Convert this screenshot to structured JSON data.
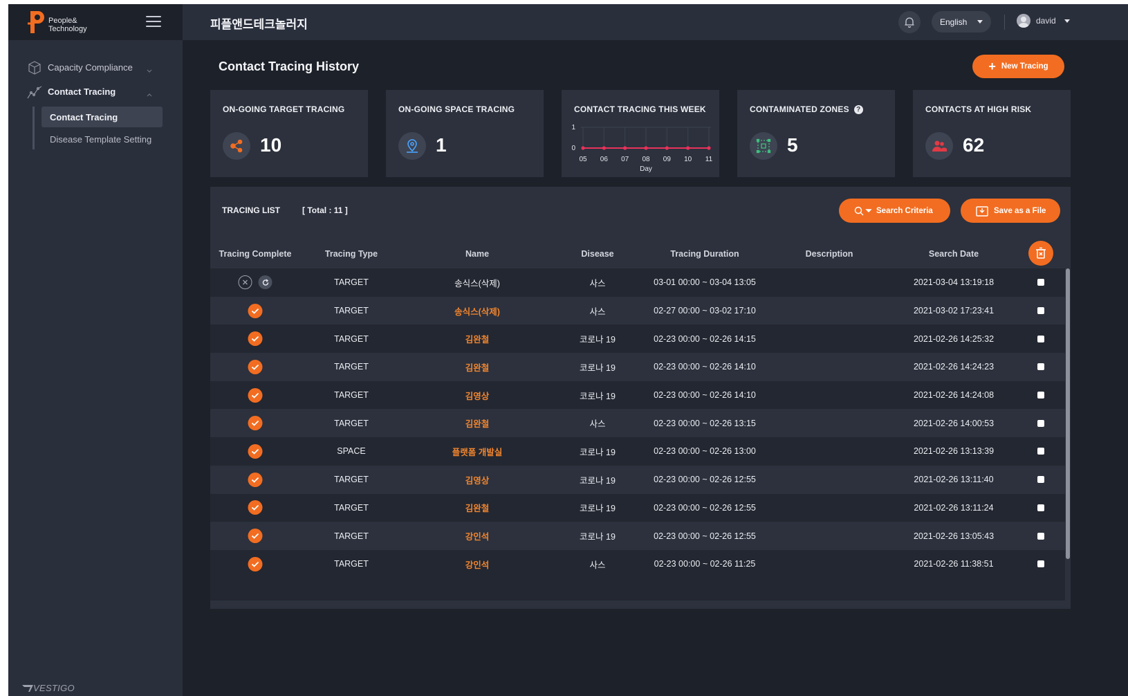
{
  "app": {
    "logo_line1": "People&",
    "logo_line2": "Technology",
    "company_name": "피플앤드테크놀러지",
    "footer_brand": "VESTIGO",
    "accent_color": "#f26d21"
  },
  "header": {
    "language": "English",
    "user": "david",
    "icons": [
      "bell-icon",
      "user-avatar-icon"
    ]
  },
  "sidebar": {
    "groups": [
      {
        "label": "Capacity Compliance",
        "icon": "cube-icon",
        "expanded": false
      },
      {
        "label": "Contact Tracing",
        "icon": "line-chart-icon",
        "expanded": true
      }
    ],
    "sub_items": [
      {
        "label": "Contact Tracing",
        "active": true
      },
      {
        "label": "Disease Template Setting",
        "active": false
      }
    ]
  },
  "page": {
    "title": "Contact Tracing History",
    "new_button": "New Tracing"
  },
  "cards": [
    {
      "title": "ON-GOING TARGET TRACING",
      "value": "10",
      "icon": "share-nodes-icon"
    },
    {
      "title": "ON-GOING SPACE TRACING",
      "value": "1",
      "icon": "map-pin-icon"
    },
    {
      "title": "CONTACT TRACING THIS WEEK",
      "icon": "none"
    },
    {
      "title": "CONTAMINATED ZONES",
      "value": "5",
      "icon": "zone-icon",
      "help": "?"
    },
    {
      "title": "CONTACTS AT HIGH RISK",
      "value": "62",
      "icon": "people-icon"
    }
  ],
  "chart_data": {
    "type": "line",
    "title": "CONTACT TRACING THIS WEEK",
    "x": [
      "05",
      "06",
      "07",
      "08",
      "09",
      "10",
      "11"
    ],
    "xlabel": "Day",
    "ylabel": "",
    "y_ticks": [
      "0",
      "1"
    ],
    "ylim": [
      0,
      1
    ],
    "series": [
      {
        "values": [
          0,
          0,
          0,
          0,
          0,
          0,
          0
        ],
        "color": "#e8325a"
      }
    ]
  },
  "list": {
    "title": "TRACING LIST",
    "total": "[ Total : 11 ]",
    "search_button": "Search Criteria",
    "save_button": "Save as a File",
    "columns": [
      "Tracing Complete",
      "Tracing Type",
      "Name",
      "Disease",
      "Tracing Duration",
      "Description",
      "Search Date"
    ],
    "rows": [
      {
        "status": "pending",
        "type": "TARGET",
        "name": "송식스(삭제)",
        "link": false,
        "disease": "사스",
        "duration": "03-01 00:00 ~ 03-04 13:05",
        "description": "",
        "date": "2021-03-04 13:19:18"
      },
      {
        "status": "done",
        "type": "TARGET",
        "name": "송식스(삭제)",
        "link": true,
        "disease": "사스",
        "duration": "02-27 00:00 ~ 03-02 17:10",
        "description": "",
        "date": "2021-03-02 17:23:41"
      },
      {
        "status": "done",
        "type": "TARGET",
        "name": "김완철",
        "link": true,
        "disease": "코로나 19",
        "duration": "02-23 00:00 ~ 02-26 14:15",
        "description": "",
        "date": "2021-02-26 14:25:32"
      },
      {
        "status": "done",
        "type": "TARGET",
        "name": "김완철",
        "link": true,
        "disease": "코로나 19",
        "duration": "02-23 00:00 ~ 02-26 14:10",
        "description": "",
        "date": "2021-02-26 14:24:23"
      },
      {
        "status": "done",
        "type": "TARGET",
        "name": "김영상",
        "link": true,
        "disease": "코로나 19",
        "duration": "02-23 00:00 ~ 02-26 14:10",
        "description": "",
        "date": "2021-02-26 14:24:08"
      },
      {
        "status": "done",
        "type": "TARGET",
        "name": "김완철",
        "link": true,
        "disease": "사스",
        "duration": "02-23 00:00 ~ 02-26 13:15",
        "description": "",
        "date": "2021-02-26 14:00:53"
      },
      {
        "status": "done",
        "type": "SPACE",
        "name": "플랫폼 개발실",
        "link": true,
        "disease": "코로나 19",
        "duration": "02-23 00:00 ~ 02-26 13:00",
        "description": "",
        "date": "2021-02-26 13:13:39"
      },
      {
        "status": "done",
        "type": "TARGET",
        "name": "김영상",
        "link": true,
        "disease": "코로나 19",
        "duration": "02-23 00:00 ~ 02-26 12:55",
        "description": "",
        "date": "2021-02-26 13:11:40"
      },
      {
        "status": "done",
        "type": "TARGET",
        "name": "김완철",
        "link": true,
        "disease": "코로나 19",
        "duration": "02-23 00:00 ~ 02-26 12:55",
        "description": "",
        "date": "2021-02-26 13:11:24"
      },
      {
        "status": "done",
        "type": "TARGET",
        "name": "강인석",
        "link": true,
        "disease": "코로나 19",
        "duration": "02-23 00:00 ~ 02-26 12:55",
        "description": "",
        "date": "2021-02-26 13:05:43"
      },
      {
        "status": "done",
        "type": "TARGET",
        "name": "강인석",
        "link": true,
        "disease": "사스",
        "duration": "02-23 00:00 ~ 02-26 11:25",
        "description": "",
        "date": "2021-02-26 11:38:51"
      }
    ]
  }
}
